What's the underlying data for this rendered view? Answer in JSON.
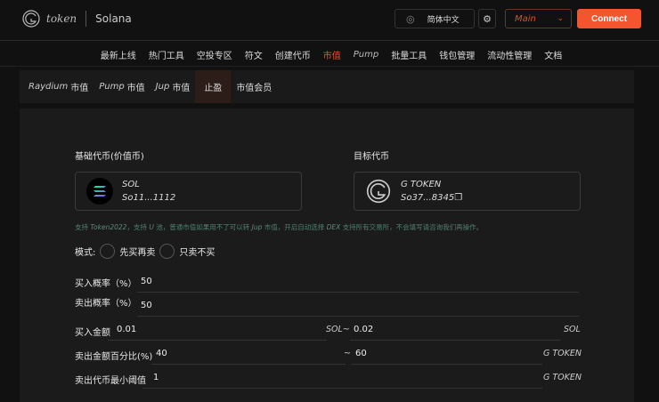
{
  "header": {
    "logo_text": "token",
    "network": "Solana",
    "language": "简体中文",
    "network_select": "Main",
    "connect_label": "Connect"
  },
  "nav": [
    "最新上线",
    "热门工具",
    "空投专区",
    "符文",
    "创建代币",
    "市值",
    "Pump",
    "批量工具",
    "钱包管理",
    "流动性管理",
    "文档"
  ],
  "subtabs": [
    {
      "em": "Raydium",
      "label": "市值"
    },
    {
      "em": "Pump",
      "label": "市值"
    },
    {
      "em": "Jup",
      "label": "市值"
    },
    {
      "em": "",
      "label": "止盈"
    },
    {
      "em": "",
      "label": "市值会员"
    }
  ],
  "base": {
    "label": "基础代币(价值币)",
    "symbol": "SOL",
    "address": "So11...1112"
  },
  "target": {
    "label": "目标代币",
    "symbol": "G TOKEN",
    "address": "So37...8345"
  },
  "note": {
    "p1": "支持 ",
    "e1": "Token2022",
    "p2": "，支持 ",
    "e2": "U",
    "p3": " 池，普通市值如果用不了可以转 ",
    "e3": "Jup",
    "p4": " 市值，开启自动选择 ",
    "e4": "DEX",
    "p5": " 支持所有交易所，不会填写请咨询我们再操作。"
  },
  "mode": {
    "label": "模式:",
    "options": [
      "先买再卖",
      "只卖不买"
    ]
  },
  "form": {
    "buy_prob": {
      "label": "买入概率（%）",
      "value": "50"
    },
    "sell_prob": {
      "label": "卖出概率（%）",
      "value": "50"
    },
    "buy_amount": {
      "label": "买入金额",
      "min": "0.01",
      "unit1": "SOL~",
      "max": "0.02",
      "unit2": "SOL"
    },
    "sell_pct": {
      "label": "卖出金额百分比(%)",
      "min": "40",
      "sep": "~",
      "max": "60",
      "unit": "G TOKEN"
    },
    "min_threshold": {
      "label": "卖出代币最小阈值",
      "value": "1",
      "unit": "G TOKEN"
    }
  },
  "colors": {
    "accent": "#f4552f",
    "bg": "#111111",
    "panel": "#1b1b1b"
  }
}
